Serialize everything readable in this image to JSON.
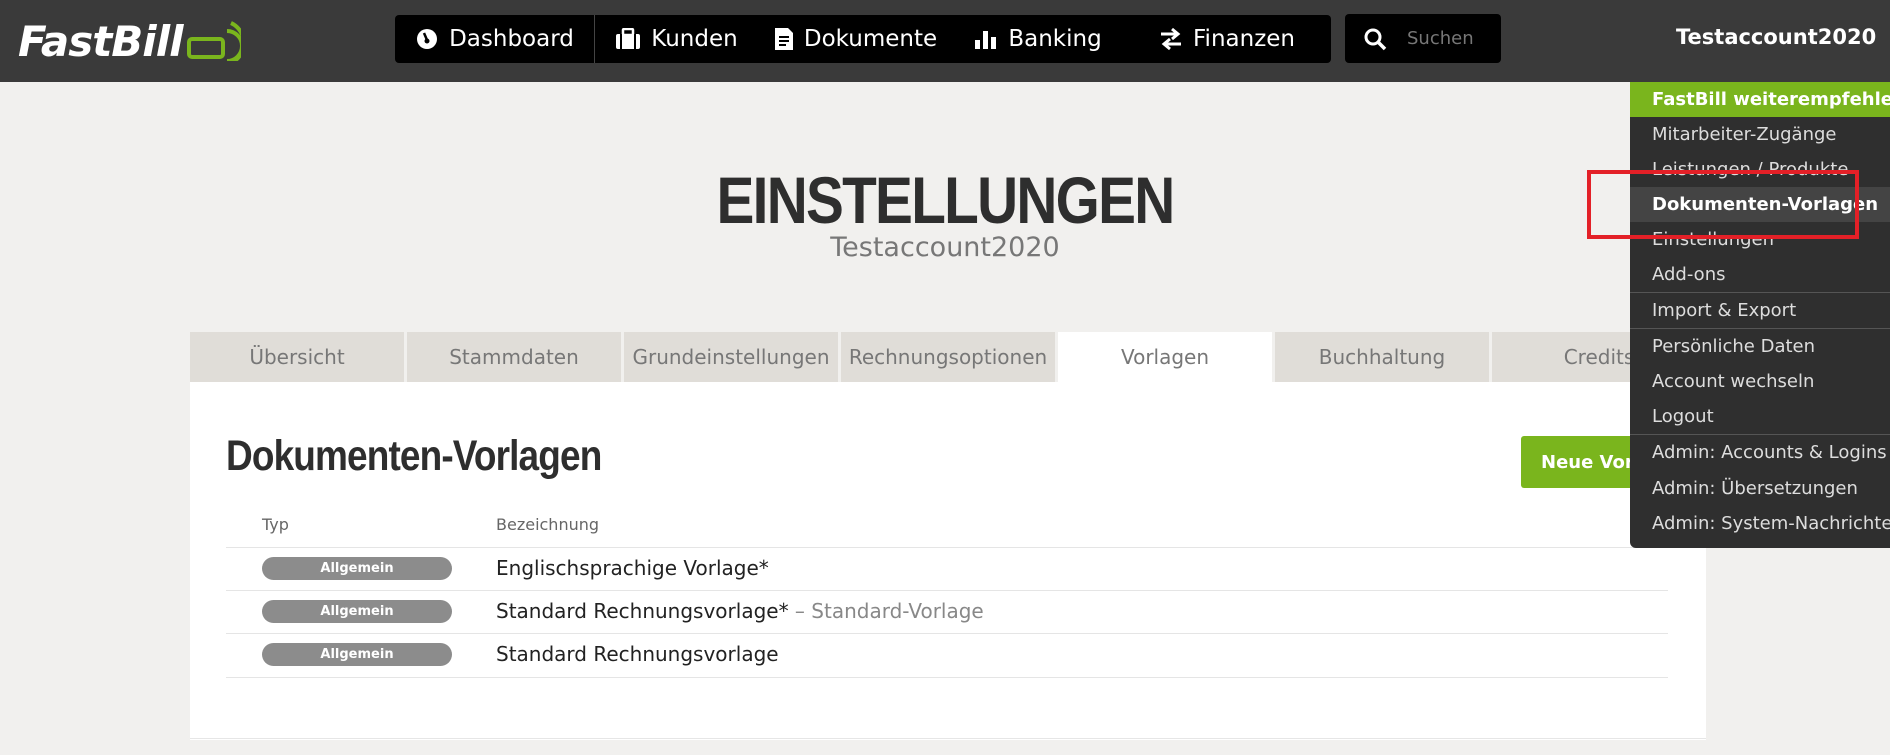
{
  "brand": {
    "name": "FastBill"
  },
  "nav": [
    {
      "label": "Dashboard",
      "icon": "gauge-icon"
    },
    {
      "label": "Kunden",
      "icon": "briefcase-icon"
    },
    {
      "label": "Dokumente",
      "icon": "document-icon"
    },
    {
      "label": "Banking",
      "icon": "bar-chart-icon"
    },
    {
      "label": "Finanzen",
      "icon": "transfer-arrows-icon"
    }
  ],
  "search": {
    "placeholder": "Suchen"
  },
  "account": {
    "name": "Testaccount2020"
  },
  "page": {
    "title": "EINSTELLUNGEN",
    "subtitle": "Testaccount2020"
  },
  "tabs": [
    "Übersicht",
    "Stammdaten",
    "Grundeinstellungen",
    "Rechnungsoptionen",
    "Vorlagen",
    "Buchhaltung",
    "Credits"
  ],
  "active_tab": "Vorlagen",
  "section": {
    "title": "Dokumenten-Vorlagen",
    "new_button": "Neue Vorla"
  },
  "table": {
    "columns": [
      "Typ",
      "Bezeichnung"
    ],
    "rows": [
      {
        "type": "Allgemein",
        "name": "Englischsprachige Vorlage*",
        "note": ""
      },
      {
        "type": "Allgemein",
        "name": "Standard Rechnungsvorlage*",
        "note": " – Standard-Vorlage"
      },
      {
        "type": "Allgemein",
        "name": "Standard Rechnungsvorlage",
        "note": ""
      }
    ]
  },
  "dropdown": {
    "items": [
      "FastBill weiterempfehlen",
      "Mitarbeiter-Zugänge",
      "Leistungen / Produkte",
      "Dokumenten-Vorlagen",
      "Einstellungen",
      "Add-ons",
      "Import & Export",
      "Persönliche Daten",
      "Account wechseln",
      "Logout",
      "Admin: Accounts & Logins",
      "Admin: Übersetzungen",
      "Admin: System-Nachrichten"
    ],
    "highlighted": "Dokumenten-Vorlagen"
  },
  "colors": {
    "accent": "#7ab51d",
    "topbar": "#3a3a3a",
    "nav": "#000000",
    "highlight": "#e32027"
  }
}
